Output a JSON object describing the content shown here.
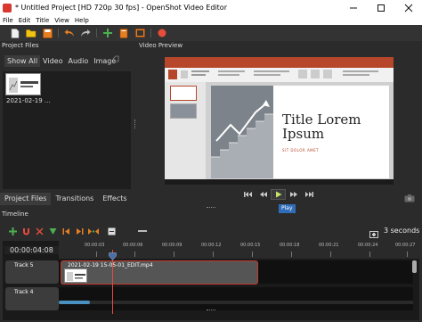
{
  "window": {
    "title": "* Untitled Project [HD 720p 30 fps] - OpenShot Video Editor",
    "minimize_icon": "minimize-icon",
    "maximize_icon": "maximize-icon",
    "close_icon": "close-icon"
  },
  "menu": [
    "File",
    "Edit",
    "Title",
    "View",
    "Help"
  ],
  "toolbar": {
    "icons": [
      "new-project-icon",
      "open-project-icon",
      "save-project-icon",
      "undo-icon",
      "redo-icon",
      "import-files-icon",
      "profile-icon",
      "fullscreen-icon",
      "export-video-icon"
    ]
  },
  "project_files": {
    "dock_title": "Project Files",
    "tabs": [
      "Show All",
      "Video",
      "Audio",
      "Image"
    ],
    "active_tab": "Show All",
    "filter_placeholder": "",
    "items": [
      {
        "name": "2021-02-19 ..."
      }
    ]
  },
  "video_preview": {
    "dock_title": "Video Preview",
    "slide": {
      "title": "Title Lorem Ipsum",
      "title_line1": "Title Lorem",
      "title_line2": "Ipsum",
      "subtitle": "SIT DOLOR AMET"
    },
    "controls": [
      "jump-start-icon",
      "rewind-icon",
      "play-icon",
      "fast-forward-icon",
      "jump-end-icon"
    ],
    "tooltip": "Play"
  },
  "bottom_tabs": {
    "items": [
      "Project Files",
      "Transitions",
      "Effects"
    ],
    "active": "Project Files"
  },
  "timeline": {
    "dock_title": "Timeline",
    "time_readout": "00:00:04:08",
    "zoom_label": "3 seconds",
    "ruler": [
      "00:00:03",
      "00:00:06",
      "00:00:09",
      "00:00:12",
      "00:00:15",
      "00:00:18",
      "00:00:21",
      "00:00:24",
      "00:00:27"
    ],
    "tracks": [
      {
        "name": "Track 5",
        "clip": "2021-02-19 15-05-01_EDIT.mp4"
      },
      {
        "name": "Track 4",
        "clip": ""
      }
    ],
    "toolbar_icons": [
      "add-track-icon",
      "snap-icon",
      "razor-icon",
      "add-marker-icon",
      "previous-marker-icon",
      "next-marker-icon",
      "center-playhead-icon",
      "zoom-out-icon",
      "zoom-slider",
      "zoom-in-icon"
    ]
  },
  "colors": {
    "background": "#2b2b2b",
    "accent_red": "#c0392b",
    "tooltip_blue": "#2f6db8",
    "toolbar_green": "#4caf50",
    "toolbar_orange": "#e67e22"
  }
}
